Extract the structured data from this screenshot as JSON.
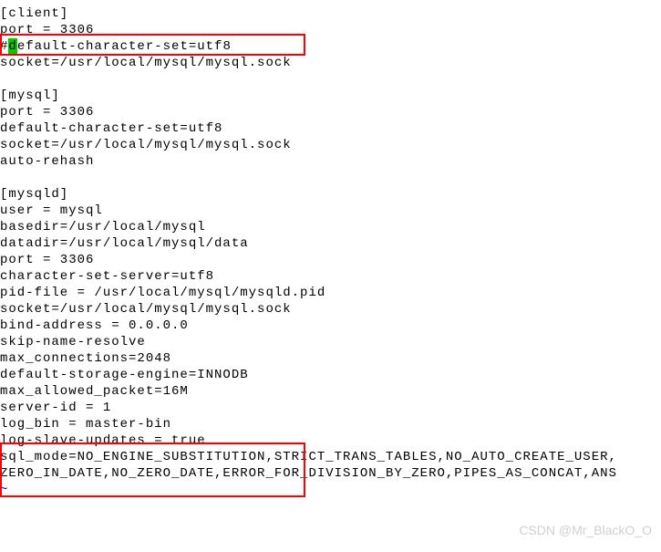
{
  "lines": {
    "l1": "[client]",
    "l2": "port = 3306",
    "l3_pre": "#",
    "l3_cursor": "d",
    "l3_post": "efault-character-set=utf8",
    "l4": "socket=/usr/local/mysql/mysql.sock",
    "l5": "",
    "l6": "[mysql]",
    "l7": "port = 3306",
    "l8": "default-character-set=utf8",
    "l9": "socket=/usr/local/mysql/mysql.sock",
    "l10": "auto-rehash",
    "l11": "",
    "l12": "[mysqld]",
    "l13": "user = mysql",
    "l14": "basedir=/usr/local/mysql",
    "l15": "datadir=/usr/local/mysql/data",
    "l16": "port = 3306",
    "l17": "character-set-server=utf8",
    "l18": "pid-file = /usr/local/mysql/mysqld.pid",
    "l19": "socket=/usr/local/mysql/mysql.sock",
    "l20": "bind-address = 0.0.0.0",
    "l21": "skip-name-resolve",
    "l22": "max_connections=2048",
    "l23": "default-storage-engine=INNODB",
    "l24": "max_allowed_packet=16M",
    "l25": "server-id = 1",
    "l26": "log_bin = master-bin",
    "l27": "log-slave-updates = true",
    "l28": "sql_mode=NO_ENGINE_SUBSTITUTION,STRICT_TRANS_TABLES,NO_AUTO_CREATE_USER,",
    "l29": "ZERO_IN_DATE,NO_ZERO_DATE,ERROR_FOR_DIVISION_BY_ZERO,PIPES_AS_CONCAT,ANS",
    "tilde": "~"
  },
  "watermark": "CSDN @Mr_BlackO_O"
}
